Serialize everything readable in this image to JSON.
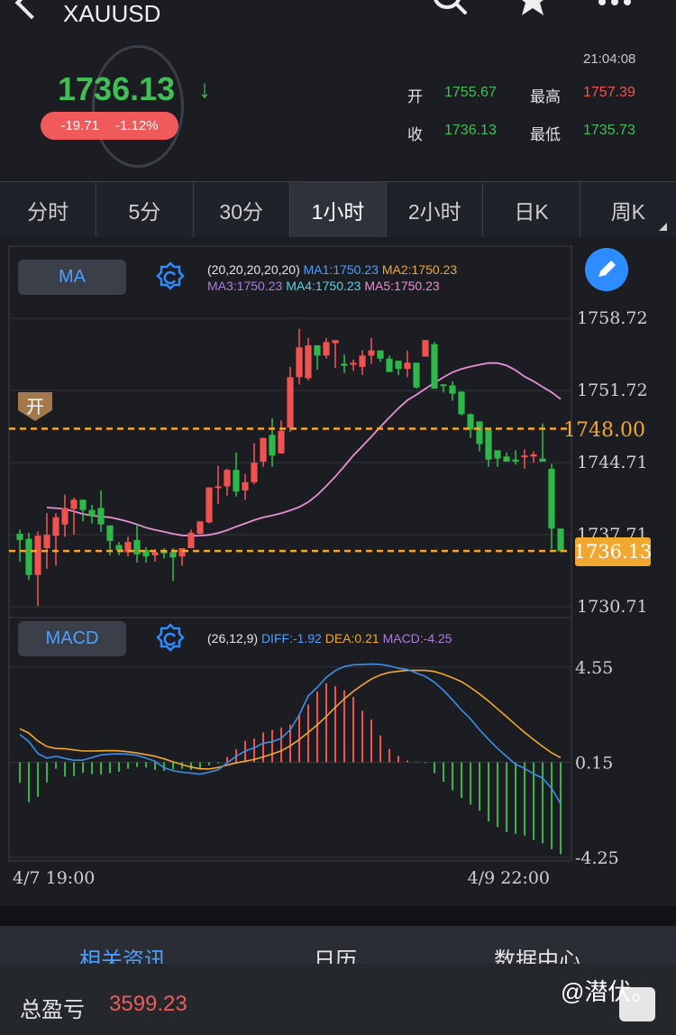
{
  "header": {
    "symbol": "XAUUSD",
    "price": "1736.13",
    "change": "-19.71",
    "change_pct": "-1.12%",
    "time": "21:04:08",
    "open_label": "开",
    "open_value": "1755.67",
    "high_label": "最高",
    "high_value": "1757.39",
    "close_label": "收",
    "close_value": "1736.13",
    "low_label": "最低",
    "low_value": "1735.73"
  },
  "tabs": [
    {
      "label": "分时",
      "active": false
    },
    {
      "label": "5分",
      "active": false
    },
    {
      "label": "30分",
      "active": false
    },
    {
      "label": "1小时",
      "active": true
    },
    {
      "label": "2小时",
      "active": false
    },
    {
      "label": "日K",
      "active": false
    },
    {
      "label": "周K",
      "active": false
    }
  ],
  "ma_panel": {
    "button": "MA",
    "params": "(20,20,20,20,20)",
    "ma1": "MA1:1750.23",
    "ma2": "MA2:1750.23",
    "ma3": "MA3:1750.23",
    "ma4": "MA4:1750.23",
    "ma5": "MA5:1750.23",
    "open_marker": "开",
    "open_line_label": "1748.00",
    "current_label": "1736.13"
  },
  "macd_panel": {
    "button": "MACD",
    "params": "(26,12,9)",
    "diff": "DIFF:-1.92",
    "dea": "DEA:0.21",
    "macd": "MACD:-4.25"
  },
  "colors": {
    "up": "#f0524f",
    "down": "#2fb84a",
    "accent": "#2d8cff",
    "ma_line": "#e98fd4",
    "diff_line": "#3d8fe8",
    "dea_line": "#f0a830",
    "dash_line": "#f0a830"
  },
  "chart_data": [
    {
      "type": "candlestick",
      "y_ticks": [
        "1758.72",
        "1751.72",
        "1744.71",
        "1737.71",
        "1730.71"
      ],
      "ylim": [
        1730.71,
        1758.72
      ],
      "x_labels": [
        "4/7 19:00",
        "4/9 22:00"
      ],
      "reference_lines": [
        1748.0,
        1736.13
      ],
      "candles": [
        [
          1737.8,
          1737.2,
          1738.2,
          1735.1
        ],
        [
          1737.3,
          1733.8,
          1737.9,
          1733.3
        ],
        [
          1733.8,
          1737.6,
          1738.0,
          1730.8
        ],
        [
          1736.4,
          1737.7,
          1739.8,
          1734.4
        ],
        [
          1737.6,
          1739.4,
          1739.8,
          1734.7
        ],
        [
          1738.7,
          1740.3,
          1741.6,
          1737.5
        ],
        [
          1740.2,
          1741.1,
          1741.3,
          1737.7
        ],
        [
          1741.1,
          1740.1,
          1740.9,
          1739.0
        ],
        [
          1740.1,
          1739.5,
          1740.6,
          1738.8
        ],
        [
          1740.3,
          1738.7,
          1742.0,
          1738.0
        ],
        [
          1738.6,
          1737.1,
          1738.6,
          1735.7
        ],
        [
          1736.7,
          1736.2,
          1737.0,
          1735.7
        ],
        [
          1736.0,
          1737.0,
          1737.5,
          1735.6
        ],
        [
          1737.2,
          1735.8,
          1738.7,
          1735.0
        ],
        [
          1736.2,
          1735.6,
          1736.5,
          1735.0
        ],
        [
          1735.7,
          1736.0,
          1736.3,
          1735.1
        ],
        [
          1736.2,
          1735.9,
          1736.4,
          1735.4
        ],
        [
          1736.0,
          1735.5,
          1736.4,
          1733.2
        ],
        [
          1735.6,
          1736.4,
          1736.4,
          1734.7
        ],
        [
          1736.4,
          1737.9,
          1738.2,
          1736.4
        ],
        [
          1737.8,
          1739.0,
          1739.0,
          1737.6
        ],
        [
          1738.9,
          1742.3,
          1742.3,
          1738.8
        ],
        [
          1742.3,
          1742.4,
          1744.4,
          1740.7
        ],
        [
          1742.4,
          1744.0,
          1744.1,
          1741.5
        ],
        [
          1744.0,
          1741.9,
          1745.7,
          1741.4
        ],
        [
          1742.0,
          1742.8,
          1743.6,
          1741.1
        ],
        [
          1742.8,
          1744.7,
          1746.6,
          1742.6
        ],
        [
          1744.8,
          1747.1,
          1747.1,
          1744.3
        ],
        [
          1747.4,
          1745.4,
          1749.0,
          1744.3
        ],
        [
          1745.6,
          1747.8,
          1748.8,
          1745.6
        ],
        [
          1748.1,
          1753.0,
          1754.0,
          1747.7
        ],
        [
          1753.0,
          1755.9,
          1757.7,
          1752.3
        ],
        [
          1752.9,
          1756.1,
          1756.8,
          1752.7
        ],
        [
          1756.1,
          1755.1,
          1756.1,
          1753.7
        ],
        [
          1755.1,
          1756.4,
          1756.8,
          1754.8
        ],
        [
          1756.3,
          1756.6,
          1756.4,
          1753.9
        ],
        [
          1754.3,
          1754.1,
          1755.2,
          1753.4
        ],
        [
          1754.2,
          1754.4,
          1754.7,
          1753.6
        ],
        [
          1754.0,
          1755.1,
          1755.6,
          1753.2
        ],
        [
          1755.1,
          1755.6,
          1756.8,
          1754.3
        ],
        [
          1755.6,
          1754.8,
          1755.3,
          1754.5
        ],
        [
          1754.8,
          1753.5,
          1755.1,
          1753.7
        ],
        [
          1754.6,
          1753.8,
          1754.6,
          1753.2
        ],
        [
          1753.8,
          1754.4,
          1755.6,
          1753.0
        ],
        [
          1754.4,
          1752.0,
          1754.3,
          1751.9
        ],
        [
          1755.0,
          1756.6,
          1756.6,
          1755.6
        ],
        [
          1756.2,
          1751.9,
          1756.4,
          1751.9
        ],
        [
          1752.3,
          1752.2,
          1752.2,
          1751.5
        ],
        [
          1752.2,
          1751.4,
          1752.6,
          1750.7
        ],
        [
          1751.6,
          1749.4,
          1751.4,
          1749.3
        ],
        [
          1749.4,
          1747.9,
          1749.5,
          1747.1
        ],
        [
          1748.7,
          1746.5,
          1748.7,
          1745.8
        ],
        [
          1747.9,
          1745.0,
          1747.9,
          1744.3
        ],
        [
          1745.9,
          1745.1,
          1745.9,
          1744.3
        ],
        [
          1745.3,
          1744.8,
          1745.7,
          1744.8
        ],
        [
          1745.0,
          1744.8,
          1745.9,
          1744.5
        ],
        [
          1745.4,
          1745.4,
          1746.0,
          1744.1
        ],
        [
          1745.3,
          1745.5,
          1745.8,
          1744.7
        ],
        [
          1745.1,
          1744.8,
          1748.5,
          1744.8
        ],
        [
          1744.1,
          1738.3,
          1744.6,
          1736.3
        ],
        [
          1738.3,
          1736.1,
          1738.3,
          1736.0
        ]
      ],
      "ma": [
        1740.34,
        1740.29,
        1740.2,
        1739.97,
        1739.72,
        1739.57,
        1739.46,
        1739.39,
        1739.2,
        1738.98,
        1738.7,
        1738.39,
        1738.18,
        1737.99,
        1737.79,
        1737.64,
        1737.6,
        1737.62,
        1737.69,
        1737.87,
        1738.14,
        1738.48,
        1738.8,
        1739.12,
        1739.38,
        1739.58,
        1739.79,
        1740.07,
        1740.39,
        1740.87,
        1741.57,
        1742.43,
        1743.34,
        1744.36,
        1745.4,
        1746.3,
        1747.22,
        1748.17,
        1749.09,
        1749.98,
        1750.76,
        1751.29,
        1751.88,
        1752.45,
        1752.99,
        1753.48,
        1753.8,
        1754.03,
        1754.21,
        1754.37,
        1754.37,
        1754.13,
        1753.68,
        1753.06,
        1752.6,
        1752.06,
        1751.53,
        1750.88
      ]
    },
    {
      "type": "macd",
      "y_ticks": [
        "4.55",
        "0.15",
        "-4.25"
      ],
      "ylim": [
        -4.25,
        4.55
      ],
      "diff": [
        1.28,
        0.96,
        0.41,
        0.19,
        0.28,
        0.18,
        0.09,
        0.1,
        0.22,
        0.34,
        0.38,
        0.39,
        0.37,
        0.32,
        0.19,
        0.05,
        -0.25,
        -0.39,
        -0.46,
        -0.5,
        -0.55,
        -0.46,
        -0.35,
        -0.03,
        0.28,
        0.52,
        0.67,
        0.88,
        0.95,
        1.11,
        1.5,
        2.19,
        3.07,
        3.47,
        3.93,
        4.24,
        4.43,
        4.51,
        4.52,
        4.54,
        4.53,
        4.46,
        4.35,
        4.29,
        4.13,
        3.97,
        3.7,
        3.33,
        2.89,
        2.42,
        2.01,
        1.5,
        1.06,
        0.64,
        0.27,
        -0.09,
        -0.28,
        -0.54,
        -0.73,
        -1.2,
        -1.92
      ],
      "dea": [
        1.55,
        1.35,
        0.99,
        0.73,
        0.64,
        0.63,
        0.57,
        0.52,
        0.52,
        0.53,
        0.54,
        0.53,
        0.49,
        0.43,
        0.36,
        0.28,
        0.16,
        0.02,
        -0.11,
        -0.22,
        -0.3,
        -0.31,
        -0.24,
        -0.13,
        -0.03,
        0.05,
        0.13,
        0.25,
        0.38,
        0.53,
        0.76,
        1.05,
        1.38,
        1.73,
        2.12,
        2.54,
        2.93,
        3.28,
        3.58,
        3.85,
        4.04,
        4.16,
        4.21,
        4.25,
        4.25,
        4.25,
        4.2,
        4.07,
        3.91,
        3.73,
        3.46,
        3.16,
        2.83,
        2.47,
        2.11,
        1.74,
        1.38,
        1.05,
        0.73,
        0.44,
        0.21
      ],
      "macd": [
        -0.95,
        -1.85,
        -1.6,
        -0.93,
        -0.3,
        -0.66,
        -0.64,
        -0.49,
        -0.55,
        -0.56,
        -0.5,
        -0.44,
        -0.3,
        -0.21,
        -0.24,
        -0.35,
        -0.4,
        -0.33,
        -0.3,
        -0.35,
        -0.34,
        -0.14,
        -0.05,
        0.24,
        0.6,
        0.99,
        1.1,
        1.38,
        1.5,
        1.6,
        1.74,
        2.19,
        2.67,
        3.27,
        3.66,
        3.52,
        3.33,
        3.02,
        2.38,
        1.97,
        1.24,
        0.61,
        0.3,
        0.09,
        0.02,
        -0.04,
        -0.5,
        -0.9,
        -1.3,
        -1.65,
        -1.96,
        -2.24,
        -2.74,
        -2.99,
        -3.23,
        -3.31,
        -3.39,
        -3.6,
        -3.75,
        -4.03,
        -4.25
      ]
    }
  ],
  "news_tabs": [
    "相关资讯",
    "日历",
    "数据中心"
  ],
  "pnl": {
    "label": "总盈亏",
    "value": "3599.23"
  },
  "watermark": "@潜伏。"
}
